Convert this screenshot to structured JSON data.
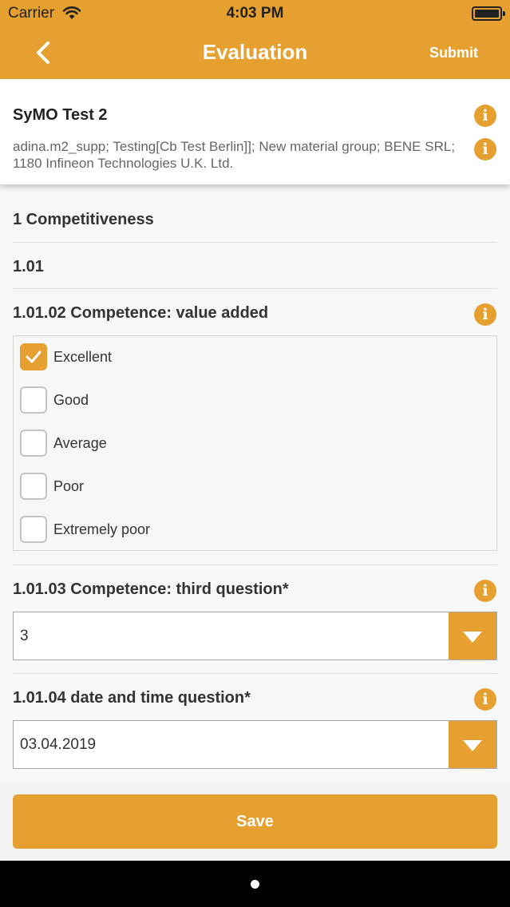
{
  "status": {
    "carrier": "Carrier",
    "time": "4:03 PM"
  },
  "nav": {
    "title": "Evaluation",
    "submit_label": "Submit"
  },
  "header": {
    "name": "SyMO Test 2",
    "description": "adina.m2_supp; Testing[Cb Test Berlin]]; New material group; BENE SRL; 1180 Infineon Technologies U.K. Ltd."
  },
  "sections": {
    "competitiveness": "1 Competitiveness",
    "subsection": "1.01",
    "q1": {
      "title": "1.01.02 Competence: value added",
      "options": [
        {
          "label": "Excellent",
          "checked": true
        },
        {
          "label": "Good",
          "checked": false
        },
        {
          "label": "Average",
          "checked": false
        },
        {
          "label": "Poor",
          "checked": false
        },
        {
          "label": "Extremely poor",
          "checked": false
        }
      ]
    },
    "q2": {
      "title": "1.01.03 Competence: third question*",
      "value": "3"
    },
    "q3": {
      "title": "1.01.04 date and time question*",
      "value": "03.04.2019"
    }
  },
  "save_label": "Save",
  "icons": {
    "info": "info-icon",
    "check": "checkmark-icon",
    "back": "chevron-left-icon",
    "dropdown": "triangle-down-icon"
  },
  "colors": {
    "accent": "#e5a02f"
  }
}
